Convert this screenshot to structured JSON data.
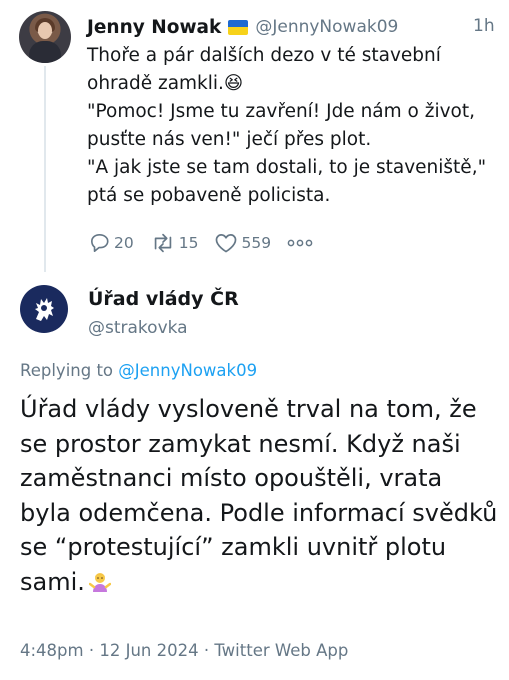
{
  "tweet1": {
    "author_name": "Jenny Nowak",
    "flag_icon": "ukraine-flag-icon",
    "handle": "@JennyNowak09",
    "time": "1h",
    "lines": [
      "Thoře a pár dalších dezo v té stavební ohradě zamkli.😆",
      "\"Pomoc! Jsme tu zavření! Jde nám o život, pusťte nás ven!\" ječí přes plot.",
      "\"A jak jste se tam dostali, to je staveniště,\" ptá se pobaveně policista."
    ],
    "actions": {
      "replies": "20",
      "retweets": "15",
      "likes": "559"
    }
  },
  "tweet2": {
    "author_name": "Úřad vlády ČR",
    "handle": "@strakovka",
    "replying_prefix": "Replying to",
    "replying_to": "@JennyNowak09",
    "text": "Úřad vlády vysloveně trval na tom, že se prostor zamykat nesmí. Když naši zaměstnanci místo opouštěli, vrata byla odemčena. Podle informací svědků se “protestující” zamkli uvnitř plotu sami.",
    "emoji": "person-shrugging-emoji",
    "meta": "4:48pm · 12 Jun 2024 · Twitter Web App"
  },
  "colors": {
    "text": "#14171a",
    "secondary": "#657786",
    "link": "#1da1f2",
    "thread_line": "#e1e8ed"
  }
}
